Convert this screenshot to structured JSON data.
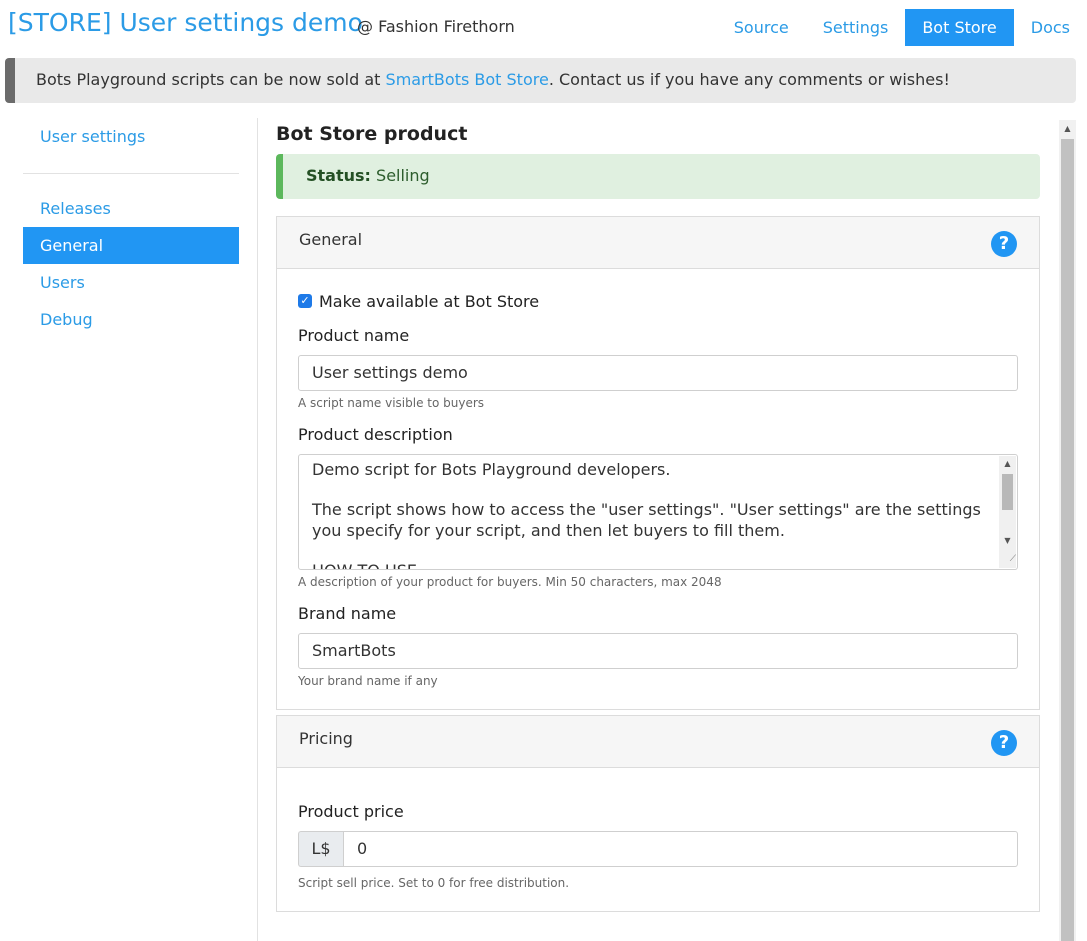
{
  "header": {
    "title": "[STORE] User settings demo",
    "owner": "@ Fashion Firethorn",
    "nav": [
      {
        "label": "Source"
      },
      {
        "label": "Settings"
      },
      {
        "label": "Bot Store",
        "active": true
      },
      {
        "label": "Docs"
      }
    ]
  },
  "banner": {
    "text_before": "Bots Playground scripts can be now sold at ",
    "link": "SmartBots Bot Store",
    "text_after": ". Contact us if you have any comments or wishes!"
  },
  "sidebar": {
    "top_item": "User settings",
    "items": [
      "Releases",
      "General",
      "Users",
      "Debug"
    ],
    "active": "General"
  },
  "main": {
    "section_title": "Bot Store product",
    "status": {
      "label": "Status:",
      "value": "Selling"
    },
    "general": {
      "title": "General",
      "help_icon": "?",
      "available_checkbox": {
        "label": "Make available at Bot Store",
        "checked": true,
        "check_glyph": "✓"
      },
      "product_name": {
        "label": "Product name",
        "value": "User settings demo",
        "help": "A script name visible to buyers"
      },
      "product_description": {
        "label": "Product description",
        "lines": [
          "Demo script for Bots Playground developers.",
          "The script shows how to access the \"user settings\". \"User settings\" are the settings you specify for your script, and then let buyers to fill them.",
          "HOW TO USE"
        ],
        "help": "A description of your product for buyers. Min 50 characters, max 2048"
      },
      "brand_name": {
        "label": "Brand name",
        "value": "SmartBots",
        "help": "Your brand name if any"
      }
    },
    "pricing": {
      "title": "Pricing",
      "help_icon": "?",
      "product_price": {
        "label": "Product price",
        "currency": "L$",
        "value": "0",
        "help": "Script sell price. Set to 0 for free distribution."
      }
    }
  },
  "colors": {
    "accent": "#2196f3",
    "link": "#2b9be6",
    "status_bg": "#e0f0e0",
    "status_border": "#5cb85c"
  }
}
